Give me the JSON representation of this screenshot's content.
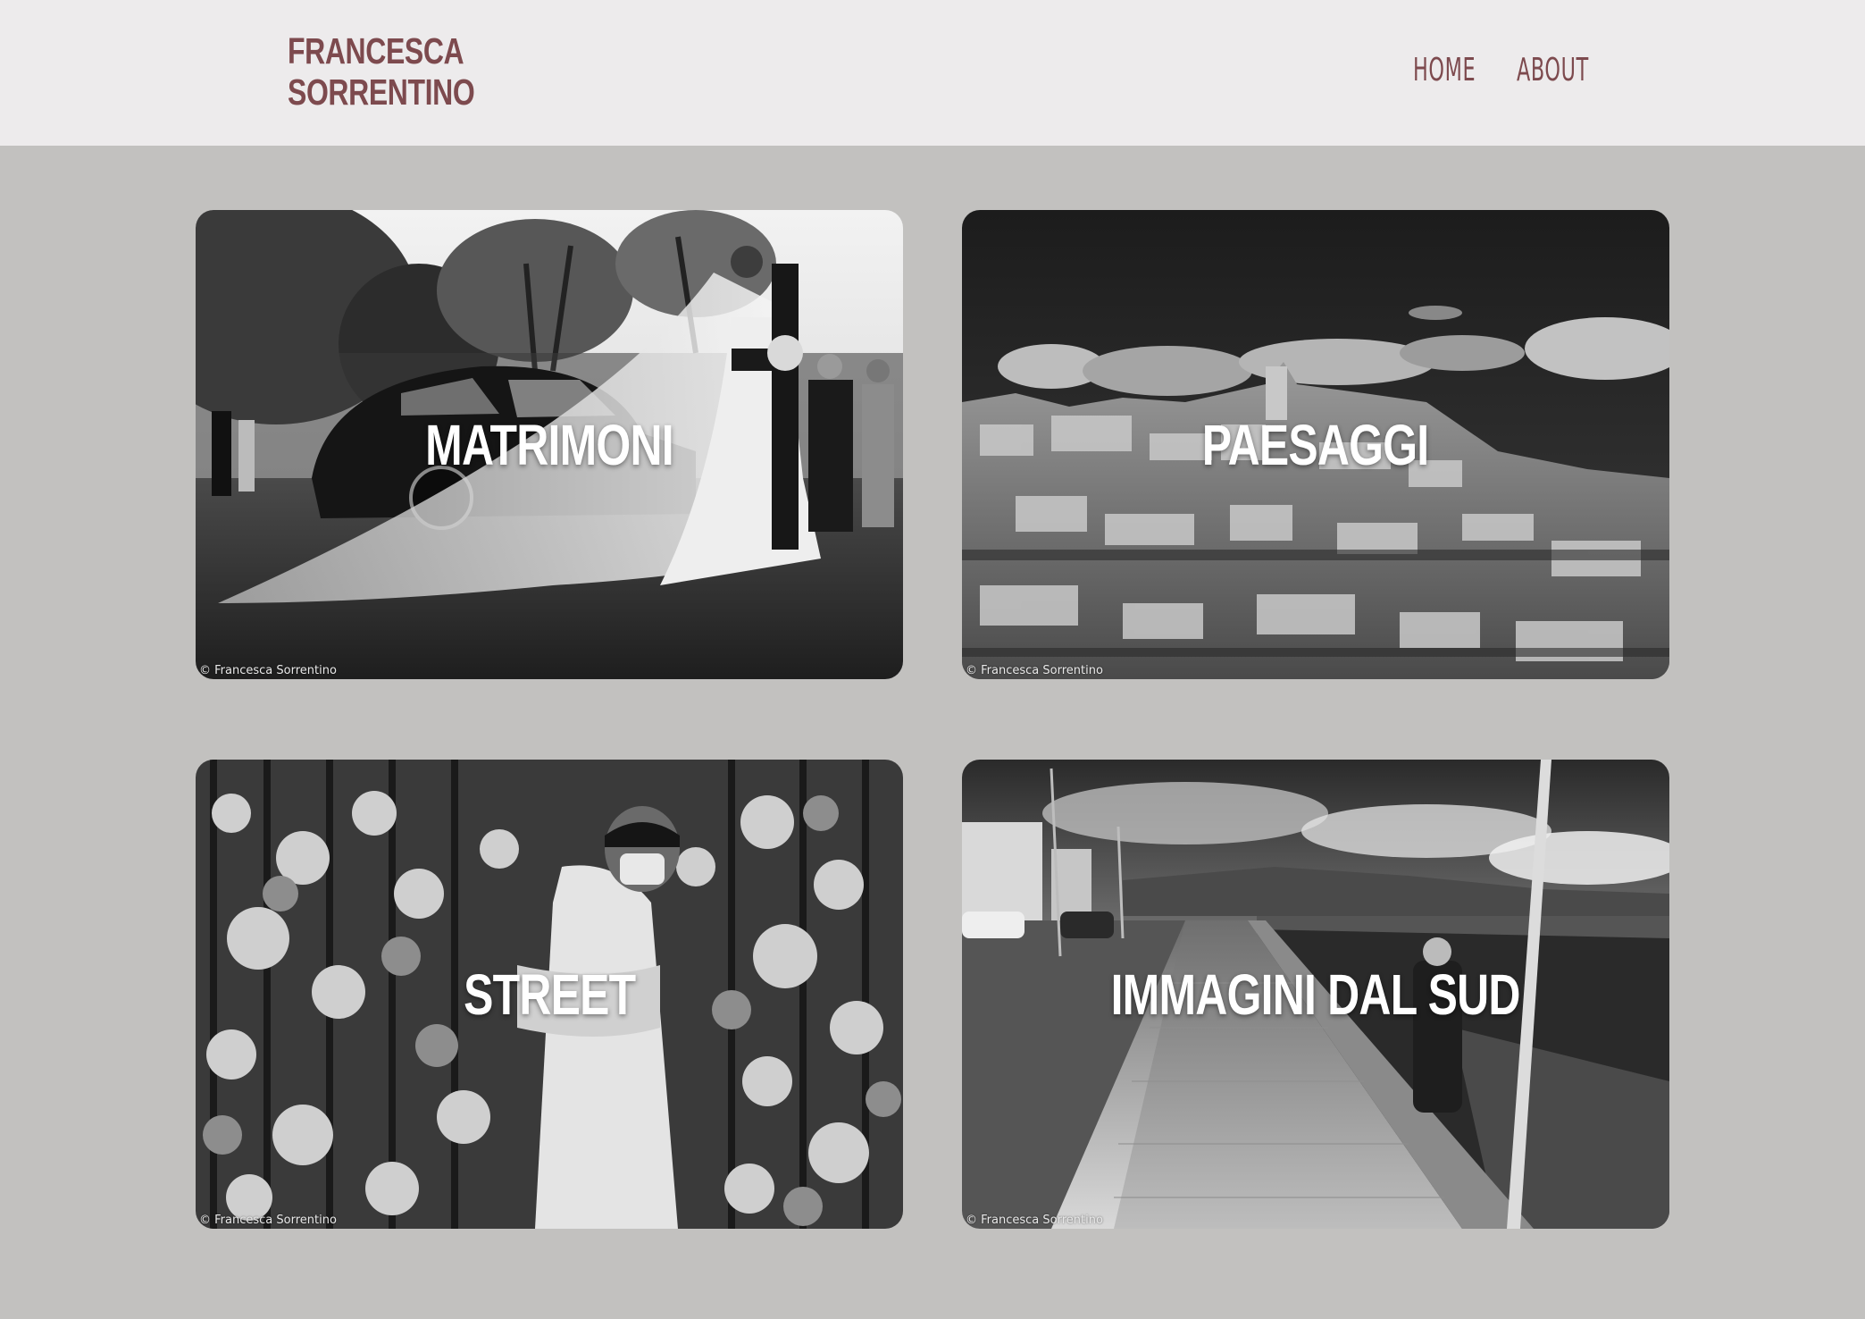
{
  "header": {
    "logo_line1": "FRANCESCA",
    "logo_line2": "SORRENTINO",
    "nav": {
      "home": "HOME",
      "about": "ABOUT"
    }
  },
  "colors": {
    "brand": "#7d4a4e",
    "header_bg": "#edebec",
    "page_bg": "#c2c1bf"
  },
  "gallery": [
    {
      "title": "MATRIMONI",
      "credit": "© Francesca Sorrentino"
    },
    {
      "title": "PAESAGGI",
      "credit": "© Francesca Sorrentino"
    },
    {
      "title": "STREET",
      "credit": "© Francesca Sorrentino"
    },
    {
      "title": "IMMAGINI DAL SUD",
      "credit": "© Francesca Sorrentino"
    }
  ]
}
